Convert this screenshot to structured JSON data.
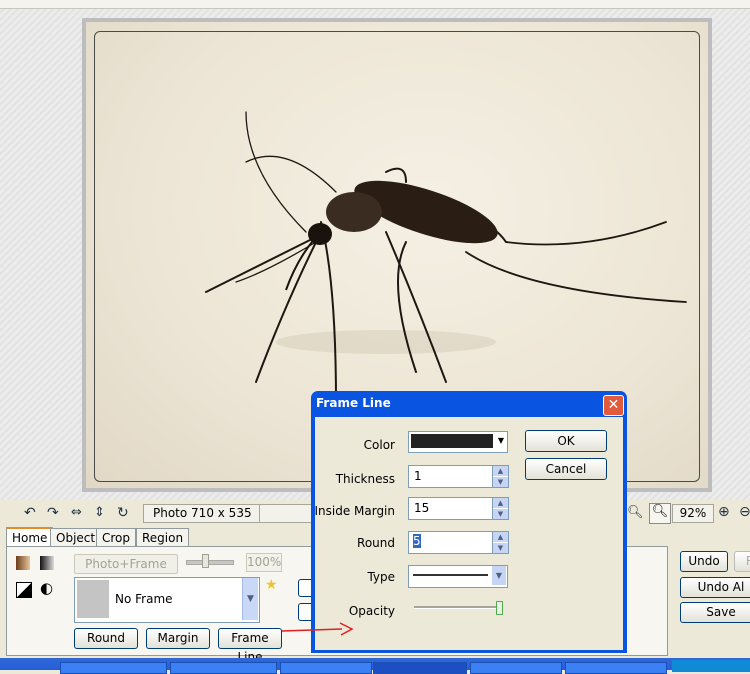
{
  "canvas": {
    "image_alt": "mosquito photo"
  },
  "status": {
    "photo_size": "Photo 710 x 535",
    "zoom": "92%"
  },
  "tabs": [
    "Home",
    "Object",
    "Crop",
    "Region"
  ],
  "home_panel": {
    "photo_frame_label": "Photo+Frame",
    "percent": "100%",
    "frame_selected": "No Frame",
    "round_label": "Round",
    "margin_label": "Margin",
    "frame_line_label": "Frame Line"
  },
  "right_buttons": {
    "undo": "Undo",
    "redo": "R",
    "undo_all": "Undo Al",
    "save": "Save"
  },
  "dialog": {
    "title": "Frame Line",
    "color_label": "Color",
    "color_value": "#222222",
    "thickness_label": "Thickness",
    "thickness_value": "1",
    "inside_margin_label": "Inside Margin",
    "inside_margin_value": "15",
    "round_label": "Round",
    "round_value": "5",
    "type_label": "Type",
    "opacity_label": "Opacity",
    "opacity_level": 1.0,
    "ok": "OK",
    "cancel": "Cancel",
    "close_glyph": "✕"
  }
}
